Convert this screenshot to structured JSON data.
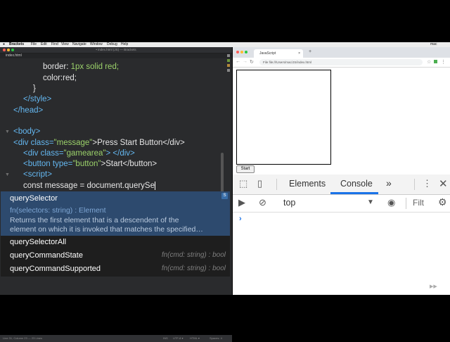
{
  "menubar": {
    "app": "Brackets",
    "items": [
      "File",
      "Edit",
      "Find",
      "View",
      "Navigate",
      "Window",
      "Debug",
      "Help"
    ],
    "right": "mac"
  },
  "editor": {
    "window_title": "• index.html (JS) — Brackets",
    "tab": "index.html",
    "lines": {
      "l1_prop": "border:",
      "l1_val": " 1px solid red;",
      "l2_prop": "color:",
      "l2_val": "red;",
      "l3": "}",
      "l4": "</style>",
      "l5": "</head>",
      "l6": "<body>",
      "l7_open": "<div ",
      "l7_attr": "class=",
      "l7_str": "\"message\"",
      "l7_text": ">Press Start Button</div>",
      "l8_open": "<div ",
      "l8_attr": "class=",
      "l8_str": "\"gamearea\"",
      "l8_close": "> </div>",
      "l9_open": "<button ",
      "l9_attr": "type=",
      "l9_str": "\"button\"",
      "l9_text": ">Start</button>",
      "l10": "<script>",
      "l11": "const message = document.querySe"
    },
    "status_left": "Line 31, Column 23 — 23 Lines",
    "status_items": [
      "INS",
      "UTF-8 ▾",
      "HTML ▾",
      "Spaces: 4"
    ]
  },
  "autocomplete": {
    "selected": "querySelector",
    "signature": "fn(selectors: string) : Element",
    "description_1": "Returns the first element that is a descendent of the",
    "description_2": "element on which it is invoked that matches the specified…",
    "tag": "S",
    "items": [
      {
        "label": "querySelectorAll",
        "hint": ""
      },
      {
        "label": "queryCommandState",
        "hint": "fn(cmd: string) : bool"
      },
      {
        "label": "queryCommandSupported",
        "hint": "fn(cmd: string) : bool"
      }
    ]
  },
  "browser": {
    "tab_title": "JavaScript",
    "url": "File  file:///Users/mac/JS/index.html",
    "start_button": "Start"
  },
  "devtools": {
    "tabs": [
      "Elements",
      "Console"
    ],
    "more": "»",
    "context": "top",
    "filter": "Filt",
    "prompt": "›"
  }
}
